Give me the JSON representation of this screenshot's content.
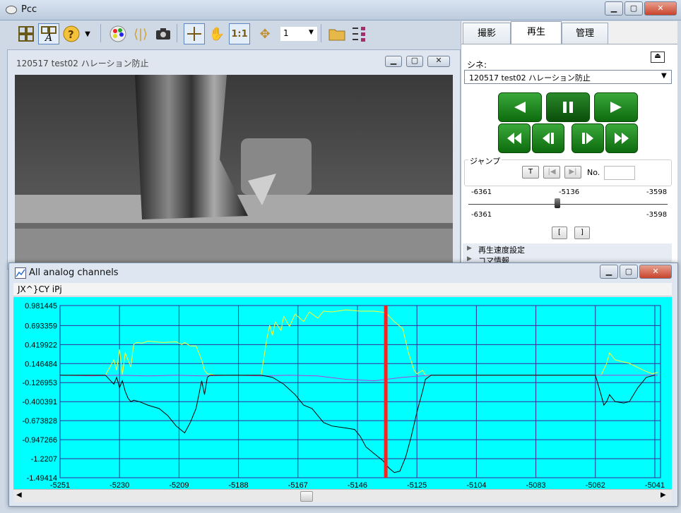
{
  "app": {
    "title": "Pcc"
  },
  "toolbar": {
    "zoom_value": "1"
  },
  "video_window": {
    "title": "120517 test02 ハレーション防止"
  },
  "right_panel": {
    "tabs": [
      {
        "label": "撮影"
      },
      {
        "label": "再生"
      },
      {
        "label": "管理"
      }
    ],
    "cine_label": "シネ:",
    "cine_value": "120517 test02 ハレーション防止",
    "jump_label": "ジャンプ",
    "jump_t": "T",
    "no_label": "No.",
    "no_value": "",
    "slider": {
      "min": "-6361",
      "current": "-5136",
      "max": "-3598",
      "min2": "-6361",
      "max2": "-3598",
      "position": 0.446
    },
    "range_start": "[",
    "range_end": "]",
    "sections": [
      {
        "label": "再生速度設定"
      },
      {
        "label": "コマ情報"
      }
    ]
  },
  "graph_window": {
    "title": "All analog channels",
    "menu": "JX^}CY iPj"
  },
  "colors": {
    "plot_bg": "#00ffff",
    "grid": "#3a2a9a",
    "cursor": "#ff2020",
    "yellow_series": "#ffff33",
    "purple_series": "#b040e0",
    "black_series": "#000000"
  },
  "chart_data": {
    "type": "line",
    "yticks": [
      "0.981445",
      "0.693359",
      "0.419922",
      "0.146484",
      "-0.126953",
      "-0.400391",
      "-0.673828",
      "-0.947266",
      "-1.2207",
      "-1.49414"
    ],
    "xticks": [
      "-5251",
      "-5230",
      "-5209",
      "-5188",
      "-5167",
      "-5146",
      "-5125",
      "-5104",
      "-5083",
      "-5062",
      "-5041"
    ],
    "ylim": [
      -1.49414,
      0.981445
    ],
    "xlim": [
      -5251,
      -5039
    ],
    "cursor_x": -5136,
    "grid": true,
    "series": [
      {
        "color": "#ffff33",
        "x": [
          -5251,
          -5235,
          -5232,
          -5231,
          -5230,
          -5229,
          -5228,
          -5226,
          -5225,
          -5224,
          -5222,
          -5220,
          -5215,
          -5210,
          -5208,
          -5207,
          -5205,
          -5203,
          -5202,
          -5201,
          -5200,
          -5199,
          -5196,
          -5190,
          -5180,
          -5178,
          -5177,
          -5176,
          -5175,
          -5173,
          -5172,
          -5170,
          -5168,
          -5165,
          -5163,
          -5160,
          -5158,
          -5155,
          -5150,
          -5145,
          -5140,
          -5136,
          -5133,
          -5130,
          -5128,
          -5126,
          -5125,
          -5123,
          -5122,
          -5060,
          -5058,
          -5057,
          -5056,
          -5055,
          -5053,
          -5050,
          -5045,
          -5042,
          -5040
        ],
        "y": [
          -0.02,
          -0.02,
          0.2,
          0.05,
          0.35,
          -0.02,
          0.3,
          0.1,
          0.42,
          0.45,
          0.44,
          0.47,
          0.45,
          0.46,
          0.42,
          0.45,
          0.4,
          0.4,
          0.3,
          0.2,
          0.05,
          0.0,
          -0.02,
          -0.02,
          -0.02,
          0.5,
          0.7,
          0.55,
          0.75,
          0.62,
          0.83,
          0.68,
          0.86,
          0.75,
          0.89,
          0.8,
          0.9,
          0.89,
          0.92,
          0.9,
          0.9,
          0.88,
          0.75,
          0.65,
          0.3,
          0.05,
          0.0,
          0.05,
          -0.02,
          -0.02,
          0.15,
          0.3,
          0.25,
          0.2,
          0.18,
          0.15,
          0.05,
          0.0,
          0.02
        ]
      },
      {
        "color": "#b040e0",
        "x": [
          -5251,
          -5240,
          -5230,
          -5220,
          -5210,
          -5200,
          -5190,
          -5180,
          -5170,
          -5160,
          -5150,
          -5140,
          -5130,
          -5120,
          -5110,
          -5100,
          -5090,
          -5080,
          -5070,
          -5060,
          -5050,
          -5040
        ],
        "y": [
          -0.02,
          -0.03,
          -0.02,
          -0.03,
          -0.02,
          -0.03,
          -0.02,
          -0.03,
          -0.02,
          -0.03,
          -0.08,
          -0.1,
          -0.05,
          -0.02,
          -0.02,
          -0.02,
          -0.02,
          -0.02,
          -0.02,
          -0.02,
          -0.02,
          -0.02
        ]
      },
      {
        "color": "#000000",
        "x": [
          -5251,
          -5235,
          -5232,
          -5231,
          -5230,
          -5229,
          -5228,
          -5227,
          -5226,
          -5225,
          -5223,
          -5220,
          -5216,
          -5213,
          -5210,
          -5207,
          -5205,
          -5203,
          -5202,
          -5201,
          -5200,
          -5199,
          -5198,
          -5196,
          -5190,
          -5180,
          -5176,
          -5172,
          -5168,
          -5165,
          -5162,
          -5160,
          -5158,
          -5155,
          -5150,
          -5147,
          -5145,
          -5143,
          -5140,
          -5137,
          -5135,
          -5133,
          -5131,
          -5129,
          -5127,
          -5125,
          -5123,
          -5122,
          -5120,
          -5062,
          -5060,
          -5059,
          -5058,
          -5057,
          -5055,
          -5052,
          -5050,
          -5047,
          -5044,
          -5041
        ],
        "y": [
          -0.02,
          -0.02,
          -0.15,
          -0.05,
          -0.2,
          -0.1,
          -0.25,
          -0.35,
          -0.4,
          -0.38,
          -0.4,
          -0.45,
          -0.5,
          -0.6,
          -0.75,
          -0.85,
          -0.7,
          -0.5,
          -0.3,
          -0.1,
          -0.3,
          -0.05,
          -0.02,
          -0.02,
          -0.02,
          -0.02,
          -0.05,
          -0.15,
          -0.3,
          -0.45,
          -0.5,
          -0.6,
          -0.7,
          -0.75,
          -0.78,
          -0.8,
          -0.9,
          -1.05,
          -1.15,
          -1.25,
          -1.35,
          -1.42,
          -1.4,
          -1.2,
          -0.9,
          -0.55,
          -0.25,
          -0.08,
          -0.02,
          -0.02,
          -0.3,
          -0.45,
          -0.4,
          -0.3,
          -0.4,
          -0.42,
          -0.4,
          -0.2,
          -0.05,
          -0.02
        ]
      }
    ]
  }
}
